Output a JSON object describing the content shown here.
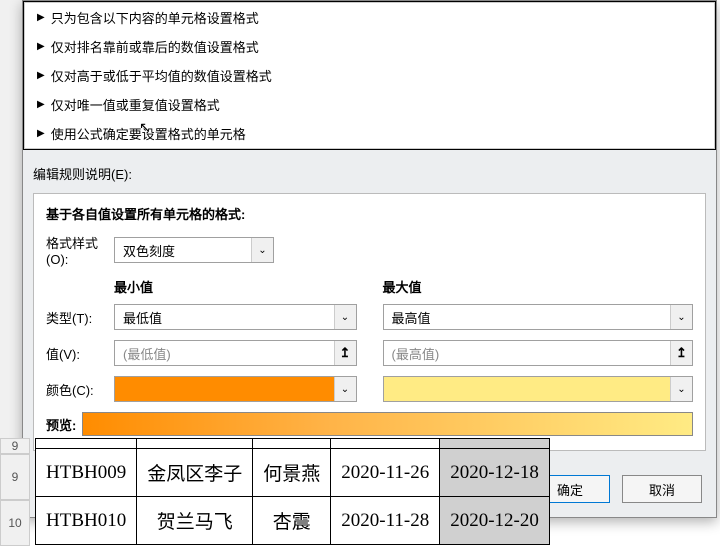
{
  "rules": [
    "只为包含以下内容的单元格设置格式",
    "仅对排名靠前或靠后的数值设置格式",
    "仅对高于或低于平均值的数值设置格式",
    "仅对唯一值或重复值设置格式",
    "使用公式确定要设置格式的单元格"
  ],
  "section_label": "编辑规则说明(E):",
  "panel": {
    "title": "基于各自值设置所有单元格的格式:",
    "format_style_label": "格式样式(O):",
    "format_style_value": "双色刻度",
    "min_label": "最小值",
    "max_label": "最大值",
    "type_label": "类型(T):",
    "type_min": "最低值",
    "type_max": "最高值",
    "value_label": "值(V):",
    "value_min_placeholder": "(最低值)",
    "value_max_placeholder": "(最高值)",
    "color_label": "颜色(C):",
    "preview_label": "预览:"
  },
  "buttons": {
    "ok": "确定",
    "cancel": "取消"
  },
  "sheet": {
    "rows": [
      {
        "num": "9",
        "cells": [
          "HTBH009",
          "金凤区李子",
          "何景燕",
          "2020-11-26",
          "2020-12-18"
        ]
      },
      {
        "num": "10",
        "cells": [
          "HTBH010",
          "贺兰马飞",
          "杏震",
          "2020-11-28",
          "2020-12-20"
        ]
      }
    ]
  }
}
